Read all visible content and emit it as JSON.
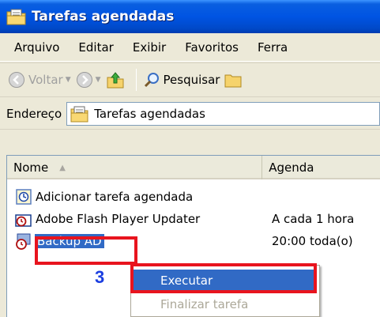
{
  "window": {
    "title": "Tarefas agendadas"
  },
  "menu": [
    "Arquivo",
    "Editar",
    "Exibir",
    "Favoritos",
    "Ferra"
  ],
  "toolbar": {
    "back_label": "Voltar",
    "search_label": "Pesquisar"
  },
  "address": {
    "label": "Endereço",
    "value": "Tarefas agendadas"
  },
  "list": {
    "columns": [
      "Nome",
      "Agenda"
    ],
    "rows": [
      {
        "name": "Adicionar tarefa agendada",
        "schedule": ""
      },
      {
        "name": "Adobe Flash Player Updater",
        "schedule": "A cada 1 hora"
      },
      {
        "name": "Backup AD",
        "schedule": "20:00 toda(o)"
      }
    ]
  },
  "annotation": {
    "step": "3"
  },
  "context_menu": {
    "items": [
      "Executar",
      "Finalizar tarefa"
    ]
  },
  "colors": {
    "title_bar": "#0054e3",
    "selection": "#316ac5",
    "highlight_box": "#e8141e",
    "step_number": "#1b3ee0"
  }
}
